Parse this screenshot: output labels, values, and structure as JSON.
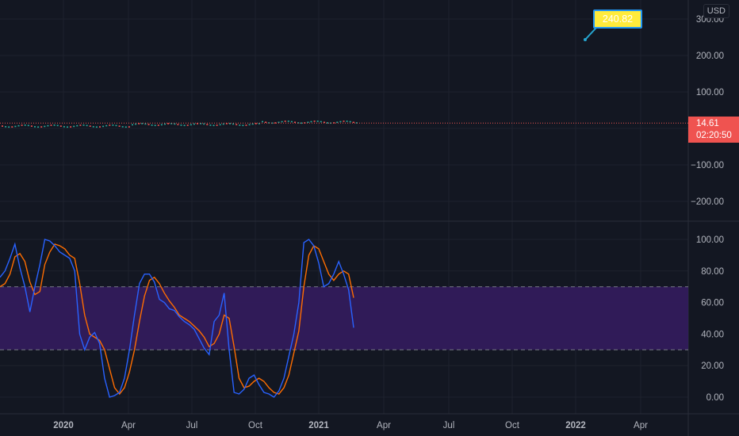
{
  "price_axis": {
    "currency": "USD",
    "main_ticks": [
      "300.00",
      "200.00",
      "100.00",
      "−100.00",
      "−200.00"
    ],
    "osc_ticks": [
      "100.00",
      "80.00",
      "60.00",
      "40.00",
      "20.00",
      "0.00"
    ]
  },
  "time_axis": {
    "ticks": [
      "2020",
      "Apr",
      "Jul",
      "Oct",
      "2021",
      "Apr",
      "Jul",
      "Oct",
      "2022",
      "Apr"
    ]
  },
  "last_price": {
    "value": "14.61",
    "countdown": "02:20:50",
    "color": "#ef5350"
  },
  "callout": {
    "label": "240.82",
    "line_color": "#26a6d1",
    "bg": "#ffeb3b",
    "border": "#2196f3"
  },
  "oscillator": {
    "upper_band": 70,
    "lower_band": 30,
    "fill_color": "#311b5c",
    "k_color": "#2962ff",
    "d_color": "#ff6d00"
  },
  "chart_data": [
    {
      "type": "line",
      "title": "",
      "ylim": [
        -250,
        320
      ],
      "horizontal_line": 240.82,
      "last_value": 14.61,
      "note_candles": "price hovering near 14.61 from late 2019 to Feb 2021"
    },
    {
      "type": "line",
      "title": "",
      "ylim": [
        -8,
        112
      ],
      "bands": [
        30,
        70
      ],
      "series": [
        {
          "k": [
            76,
            80,
            88,
            97,
            82,
            70,
            54,
            70,
            84,
            100,
            99,
            96,
            92,
            90,
            88,
            80,
            40,
            30,
            38,
            41,
            34,
            12,
            0,
            1,
            3,
            12,
            30,
            52,
            72,
            78,
            78,
            73,
            62,
            60,
            56,
            55,
            51,
            48,
            46,
            43,
            37,
            31,
            27,
            48,
            52,
            66,
            30,
            3,
            2,
            5,
            12,
            14,
            8,
            3,
            2,
            0,
            4,
            12,
            26,
            40,
            60,
            98,
            100,
            96,
            85,
            70,
            72,
            78,
            86,
            78,
            68,
            44
          ],
          "d": [
            70,
            72,
            78,
            89,
            91,
            86,
            73,
            65,
            67,
            84,
            92,
            97,
            96,
            94,
            90,
            88,
            72,
            52,
            40,
            38,
            36,
            30,
            18,
            6,
            2,
            6,
            16,
            30,
            48,
            64,
            74,
            76,
            72,
            66,
            61,
            57,
            52,
            50,
            48,
            45,
            42,
            38,
            32,
            34,
            40,
            52,
            50,
            32,
            12,
            6,
            7,
            10,
            12,
            10,
            6,
            3,
            2,
            6,
            14,
            28,
            42,
            70,
            90,
            96,
            94,
            86,
            78,
            74,
            78,
            80,
            78,
            63
          ]
        }
      ]
    }
  ]
}
